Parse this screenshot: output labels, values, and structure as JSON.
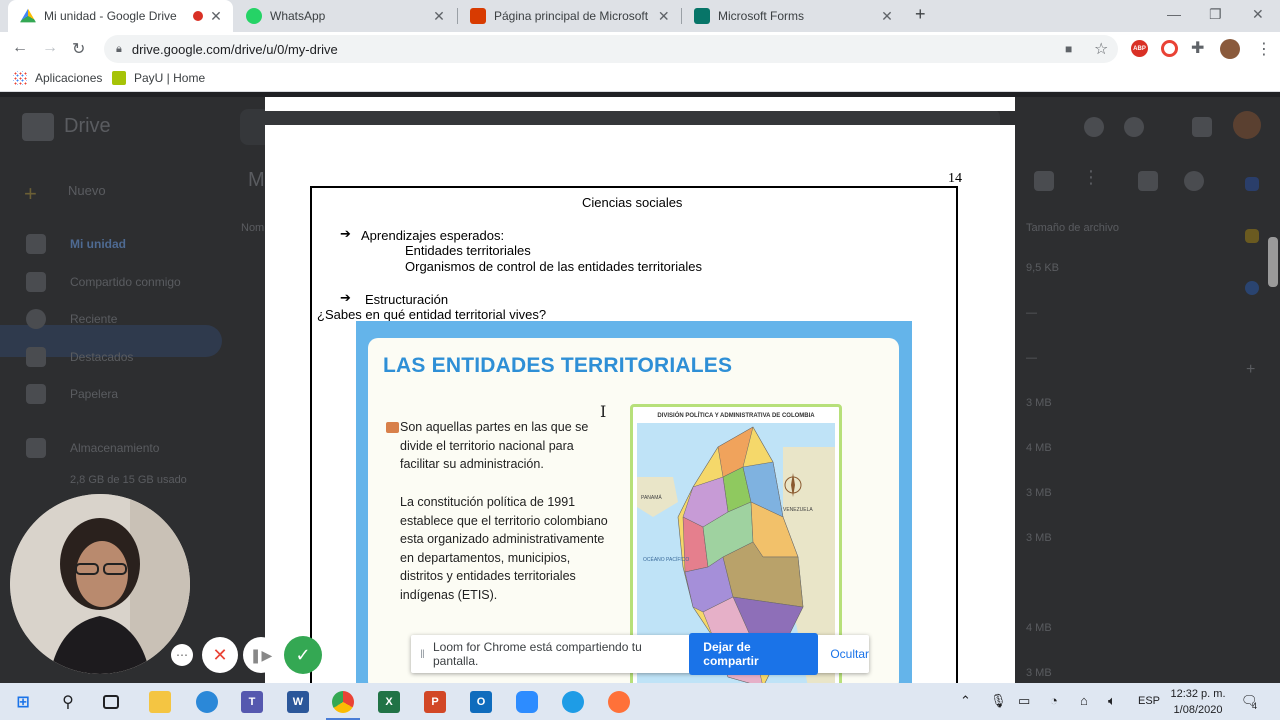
{
  "browser": {
    "tabs": [
      {
        "title": "Mi unidad - Google Drive",
        "active": true,
        "recording": true
      },
      {
        "title": "WhatsApp",
        "active": false
      },
      {
        "title": "Página principal de Microsoft Offi",
        "active": false
      },
      {
        "title": "Microsoft Forms",
        "active": false
      }
    ],
    "address": "drive.google.com/drive/u/0/my-drive",
    "bookmarks": [
      "Aplicaciones",
      "PayU | Home"
    ],
    "extension_abp": "ABP"
  },
  "drive": {
    "app_name": "Drive",
    "new_button": "Nuevo",
    "nav": [
      "Mi unidad",
      "Compartido conmigo",
      "Reciente",
      "Destacados",
      "Papelera"
    ],
    "storage_label": "Almacenamiento",
    "storage_usage": "2,8 GB de 15 GB usado",
    "header_initial": "Mi",
    "column_owner": "Nom",
    "column_size": "Tamaño de archivo",
    "sizes": [
      "9,5 KB",
      "—",
      "—",
      "3 MB",
      "4 MB",
      "3 MB",
      "3 MB",
      "4 MB",
      "3 MB"
    ]
  },
  "document": {
    "page_number": "14",
    "subject": "Ciencias sociales",
    "arrow_glyph": "➔",
    "learning_title": "Aprendizajes esperados:",
    "learning_items": [
      "Entidades territoriales",
      "Organismos de control de las entidades territoriales"
    ],
    "structure_title": "Estructuración",
    "question": "¿Sabes en qué entidad territorial vives?",
    "slide": {
      "title": "LAS ENTIDADES TERRITORIALES",
      "para1": [
        "Son aquellas partes en las que se",
        "divide el territorio nacional para",
        "facilitar su administración."
      ],
      "para2": [
        "La constitución política de 1991",
        "establece que el territorio colombiano",
        "esta organizado administrativamente",
        "en departamentos, municipios,",
        "distritos y entidades territoriales",
        "indígenas (ETIS)."
      ],
      "map_title": "DIVISIÓN POLÍTICA Y ADMINISTRATIVA DE COLOMBIA",
      "map_labels": [
        "PANAMÁ",
        "VENEZUELA",
        "OCÉANO PACÍFICO"
      ]
    }
  },
  "loom": {
    "sharing_text": "Loom for Chrome está compartiendo tu pantalla.",
    "stop_button": "Dejar de compartir",
    "hide_button": "Ocultar"
  },
  "taskbar": {
    "apps": [
      "start-icon",
      "search-icon",
      "task-view-icon",
      "file-explorer-icon",
      "edge-legacy-icon",
      "teams-icon",
      "word-icon",
      "chrome-icon",
      "excel-icon",
      "powerpoint-icon",
      "outlook-icon",
      "zoom-icon",
      "edge-icon",
      "firefox-icon"
    ],
    "app_letters": {
      "teams": "T",
      "word": "W",
      "excel": "X",
      "powerpoint": "P",
      "outlook": "O"
    },
    "language": "ESP",
    "time": "12:32 p. m.",
    "date": "1/08/2020",
    "notifications": "4"
  },
  "colors": {
    "accent_blue": "#1a73e8",
    "slide_title": "#2e8fd6",
    "slide_frame": "#64b4ea",
    "map_border": "#b7e07a",
    "confirm_green": "#34a853",
    "cancel_red": "#ea4335"
  }
}
